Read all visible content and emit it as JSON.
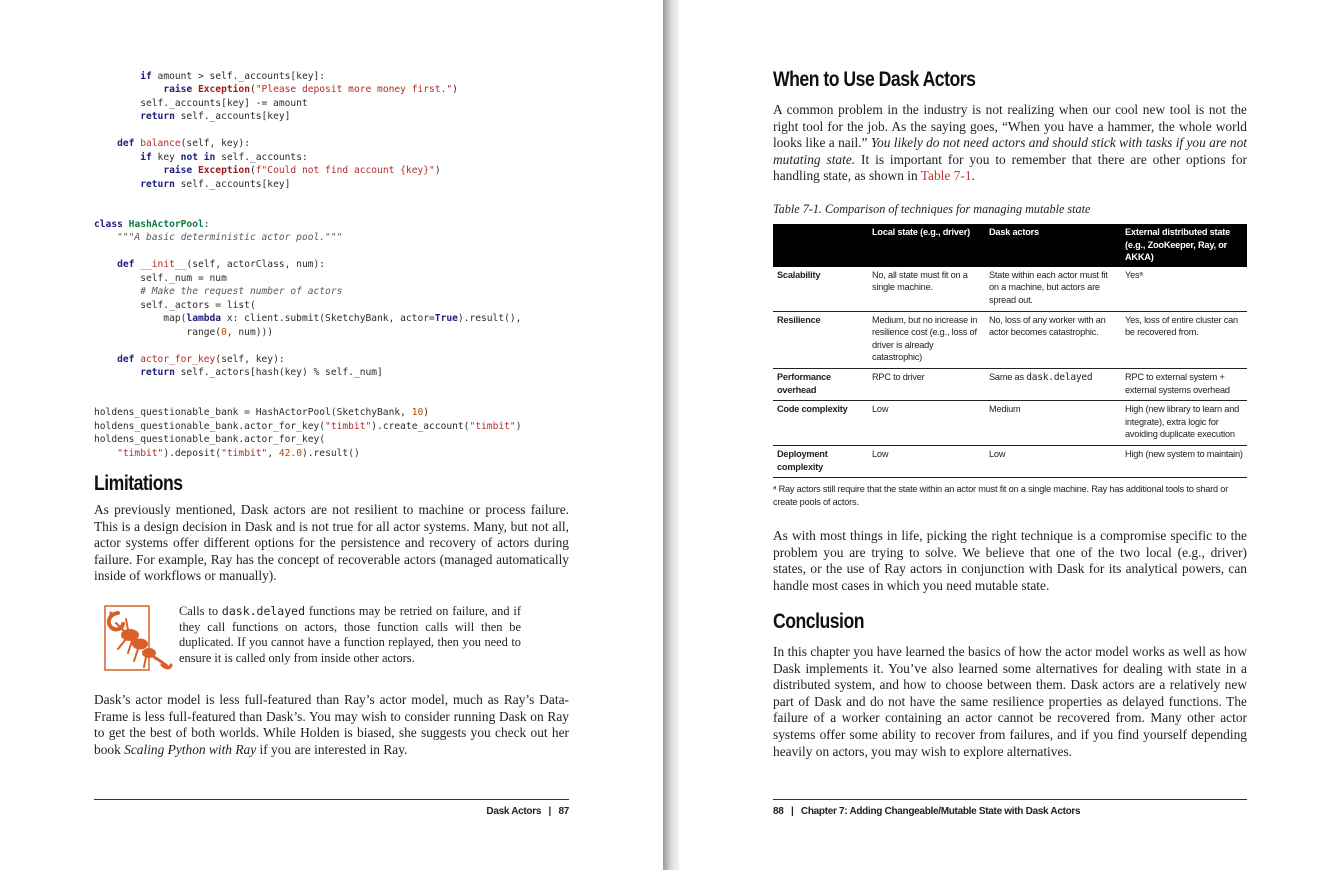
{
  "left_page": {
    "code_block_1": "        if amount > self._accounts[key]:\n            raise Exception(\"Please deposit more money first.\")\n        self._accounts[key] -= amount\n        return self._accounts[key]\n\n    def balance(self, key):\n        if key not in self._accounts:\n            raise Exception(f\"Could not find account {key}\")\n        return self._accounts[key]\n\n\nclass HashActorPool:\n    \"\"\"A basic deterministic actor pool.\"\"\"\n\n    def __init__(self, actorClass, num):\n        self._num = num\n        # Make the request number of actors\n        self._actors = list(\n            map(lambda x: client.submit(SketchyBank, actor=True).result(),\n                range(0, num)))\n\n    def actor_for_key(self, key):\n        return self._actors[hash(key) % self._num]\n\n\nholdens_questionable_bank = HashActorPool(SketchyBank, 10)\nholdens_questionable_bank.actor_for_key(\"timbit\").create_account(\"timbit\")\nholdens_questionable_bank.actor_for_key(\n    \"timbit\").deposit(\"timbit\", 42.0).result()",
    "heading": "Limitations",
    "para1": "As previously mentioned, Dask actors are not resilient to machine or process failure. This is a design decision in Dask and is not true for all actor systems. Many, but not all, actor systems offer different options for the persistence and recovery of actors during failure. For example, Ray has the concept of recoverable actors (managed automatically inside of workflows or manually).",
    "warning": {
      "icon": "scorpion-warning-icon",
      "t1": "Calls to ",
      "code": "dask.delayed",
      "t2": " functions may be retried on failure, and if they call functions on actors, those function calls will then be duplicated. If you cannot have a function replayed, then you need to ensure it is called only from inside other actors."
    },
    "para2": {
      "t1": "Dask’s actor model is less full-featured than Ray’s actor model, much as Ray’s Data­Frame is less full-featured than Dask’s. You may wish to consider running Dask on Ray to get the best of both worlds. While Holden is biased, she suggests you check out her book ",
      "book": "Scaling Python with Ray",
      "t2": " if you are interested in Ray."
    },
    "footer": "Dask Actors   |   87"
  },
  "right_page": {
    "heading1": "When to Use Dask Actors",
    "para1": {
      "t1": "A common problem in the industry is not realizing when our cool new tool is not the right tool for the job. As the saying goes, “When you have a hammer, the whole world looks like a nail.” ",
      "em": "You likely do not need actors and should stick with tasks if you are not mutating state.",
      "t2": " It is important for you to remember that there are other options for handling state, as shown in ",
      "xref": "Table 7-1",
      "t3": "."
    },
    "table_caption": "Table 7-1. Comparison of techniques for managing mutable state",
    "table": {
      "headers": [
        "",
        "Local state (e.g., driver)",
        "Dask actors",
        "External distributed state (e.g., ZooKeeper, Ray, or AKKA)"
      ],
      "rows": [
        {
          "label": "Scalability",
          "c1": "No, all state must fit on a single machine.",
          "c2": "State within each actor must fit on a machine, but actors are spread out.",
          "c3": "Yesᵃ"
        },
        {
          "label": "Resilience",
          "c1": "Medium, but no increase in resilience cost (e.g., loss of driver is already catastrophic)",
          "c2": "No, loss of any worker with an actor becomes catastrophic.",
          "c3": "Yes, loss of entire cluster can be recovered from."
        },
        {
          "label": "Performance overhead",
          "c1": "RPC to driver",
          "c2a": "Same as ",
          "c2code": "dask.delayed",
          "c3": "RPC to external system + external systems overhead"
        },
        {
          "label": "Code complexity",
          "c1": "Low",
          "c2": "Medium",
          "c3": "High (new library to learn and integrate), extra logic for avoiding duplicate execution"
        },
        {
          "label": "Deployment complexity",
          "c1": "Low",
          "c2": "Low",
          "c3": "High (new system to maintain)"
        }
      ],
      "footnote": "ᵃ Ray actors still require that the state within an actor must fit on a single machine. Ray has additional tools to shard or create pools of actors."
    },
    "para2": "As with most things in life, picking the right technique is a compromise specific to the problem you are trying to solve. We believe that one of the two local (e.g., driver) states, or the use of Ray actors in conjunction with Dask for its analytical powers, can handle most cases in which you need mutable state.",
    "heading2": "Conclusion",
    "para3": "In this chapter you have learned the basics of how the actor model works as well as how Dask implements it. You’ve also learned some alternatives for dealing with state in a distributed system, and how to choose between them. Dask actors are a relatively new part of Dask and do not have the same resilience properties as delayed functions. The failure of a worker containing an actor cannot be recovered from. Many other actor systems offer some ability to recover from failures, and if you find yourself depending heavily on actors, you may wish to explore alternatives.",
    "footer": "88   |   Chapter 7: Adding Changeable/Mutable State with Dask Actors"
  }
}
